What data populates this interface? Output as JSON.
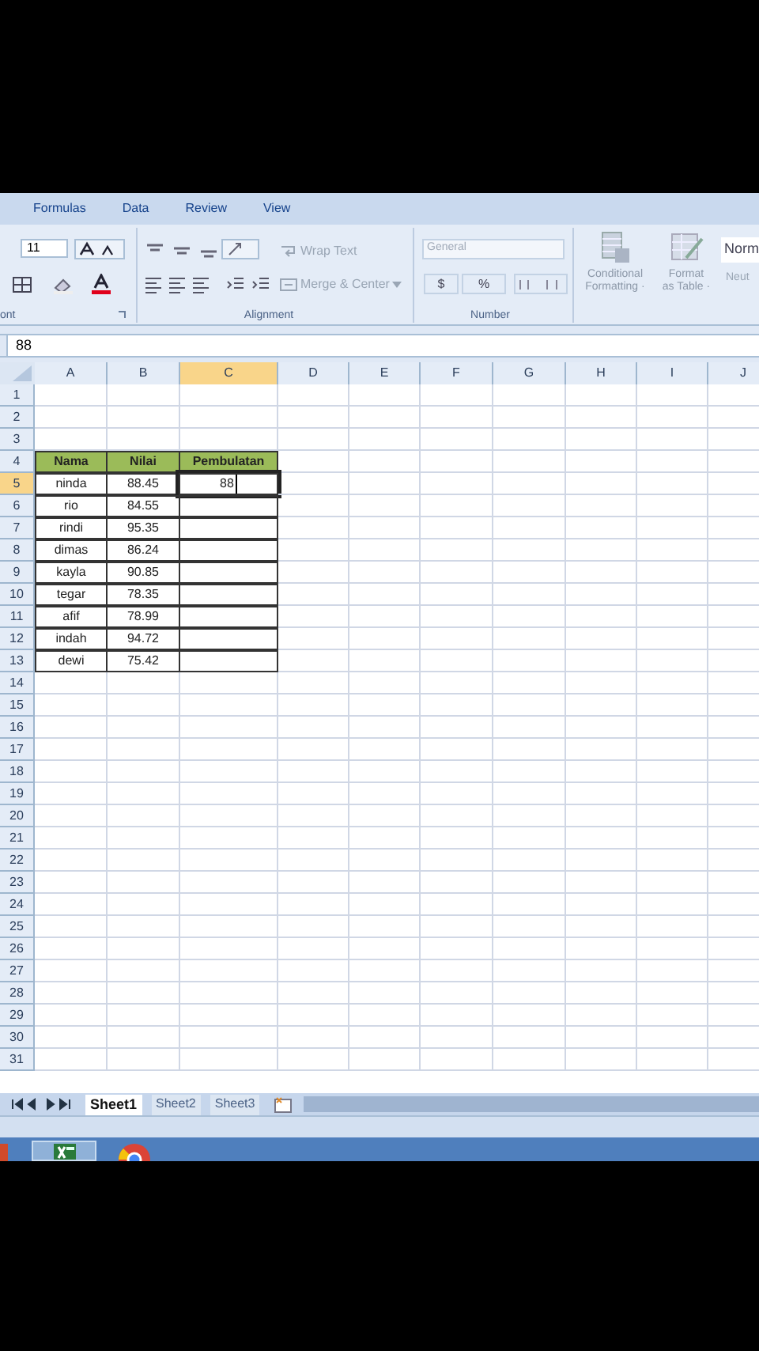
{
  "ribbon_tabs": [
    {
      "label": "Formulas",
      "selected": false
    },
    {
      "label": "Data",
      "selected": false
    },
    {
      "label": "Review",
      "selected": false
    },
    {
      "label": "View",
      "selected": false
    }
  ],
  "ribbon": {
    "font_size": "11",
    "wrap_text": "Wrap Text",
    "merge_center": "Merge & Center",
    "number_format": "General",
    "currency": "$",
    "percent": "%",
    "conditional_formatting": [
      "Conditional",
      "Formatting ·"
    ],
    "format_as_table": [
      "Format",
      "as Table ·"
    ],
    "styles": [
      "Norm",
      "Neut"
    ],
    "group_labels": [
      "ont",
      "Alignment",
      "Number"
    ]
  },
  "formula_bar": {
    "value": "88"
  },
  "columns": [
    {
      "label": "A",
      "selected": false
    },
    {
      "label": "B",
      "selected": false
    },
    {
      "label": "C",
      "selected": true
    },
    {
      "label": "D",
      "selected": false
    },
    {
      "label": "E",
      "selected": false
    },
    {
      "label": "F",
      "selected": false
    },
    {
      "label": "G",
      "selected": false
    },
    {
      "label": "H",
      "selected": false
    },
    {
      "label": "I",
      "selected": false
    },
    {
      "label": "J",
      "selected": false
    }
  ],
  "rows": [
    {
      "label": "1",
      "selected": false
    },
    {
      "label": "2",
      "selected": false
    },
    {
      "label": "3",
      "selected": false
    },
    {
      "label": "4",
      "selected": false,
      "cells": [
        {
          "kind": "header",
          "text": "Nama"
        },
        {
          "kind": "header",
          "text": "Nilai"
        },
        {
          "kind": "header",
          "text": "Pembulatan"
        }
      ]
    },
    {
      "label": "5",
      "selected": true,
      "cells": [
        {
          "kind": "data",
          "text": "ninda"
        },
        {
          "kind": "data",
          "text": "88.45"
        },
        {
          "kind": "editing",
          "text": "88"
        }
      ]
    },
    {
      "label": "6",
      "selected": false,
      "cells": [
        {
          "kind": "data",
          "text": "rio"
        },
        {
          "kind": "data",
          "text": "84.55"
        },
        {
          "kind": "data"
        }
      ]
    },
    {
      "label": "7",
      "selected": false,
      "cells": [
        {
          "kind": "data",
          "text": "rindi"
        },
        {
          "kind": "data",
          "text": "95.35"
        },
        {
          "kind": "data"
        }
      ]
    },
    {
      "label": "8",
      "selected": false,
      "cells": [
        {
          "kind": "data",
          "text": "dimas"
        },
        {
          "kind": "data",
          "text": "86.24"
        },
        {
          "kind": "data"
        }
      ]
    },
    {
      "label": "9",
      "selected": false,
      "cells": [
        {
          "kind": "data",
          "text": "kayla"
        },
        {
          "kind": "data",
          "text": "90.85"
        },
        {
          "kind": "data"
        }
      ]
    },
    {
      "label": "10",
      "selected": false,
      "cells": [
        {
          "kind": "data",
          "text": "tegar"
        },
        {
          "kind": "data",
          "text": "78.35"
        },
        {
          "kind": "data"
        }
      ]
    },
    {
      "label": "11",
      "selected": false,
      "cells": [
        {
          "kind": "data",
          "text": "afif"
        },
        {
          "kind": "data",
          "text": "78.99"
        },
        {
          "kind": "data"
        }
      ]
    },
    {
      "label": "12",
      "selected": false,
      "cells": [
        {
          "kind": "data",
          "text": "indah"
        },
        {
          "kind": "data",
          "text": "94.72"
        },
        {
          "kind": "data"
        }
      ]
    },
    {
      "label": "13",
      "selected": false,
      "cells": [
        {
          "kind": "data",
          "text": "dewi"
        },
        {
          "kind": "data",
          "text": "75.42"
        },
        {
          "kind": "data"
        }
      ]
    },
    {
      "label": "14",
      "selected": false
    },
    {
      "label": "15",
      "selected": false
    },
    {
      "label": "16",
      "selected": false
    },
    {
      "label": "17",
      "selected": false
    },
    {
      "label": "18",
      "selected": false
    },
    {
      "label": "19",
      "selected": false
    },
    {
      "label": "20",
      "selected": false
    },
    {
      "label": "21",
      "selected": false
    },
    {
      "label": "22",
      "selected": false
    },
    {
      "label": "23",
      "selected": false
    },
    {
      "label": "24",
      "selected": false
    },
    {
      "label": "25",
      "selected": false
    },
    {
      "label": "26",
      "selected": false
    },
    {
      "label": "27",
      "selected": false
    },
    {
      "label": "28",
      "selected": false
    },
    {
      "label": "29",
      "selected": false
    },
    {
      "label": "30",
      "selected": false
    },
    {
      "label": "31",
      "selected": false
    }
  ],
  "sheet_tabs": [
    {
      "label": "Sheet1",
      "selected": true
    },
    {
      "label": "Sheet2",
      "selected": false
    },
    {
      "label": "Sheet3",
      "selected": false
    }
  ]
}
